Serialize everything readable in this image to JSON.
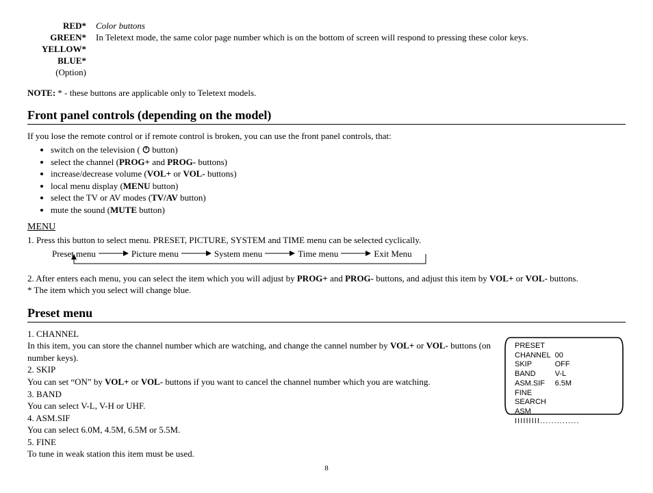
{
  "color_buttons": {
    "labels": [
      "RED*",
      "GREEN*",
      "YELLOW*",
      "BLUE*"
    ],
    "option": "(Option)",
    "title": "Color buttons",
    "desc": "In Teletext mode, the same color page number which is on the bottom of screen will respond to pressing these color keys."
  },
  "note": {
    "label": "NOTE:",
    "text": " * - these buttons are applicable only to Teletext models."
  },
  "section1": {
    "title": "Front panel controls (depending on the model)",
    "intro": "If you lose the remote control or if remote control is broken, you can use the front panel controls, that:",
    "bullets": {
      "b1a": "switch on the television ( ",
      "b1b": " button)",
      "b2a": "select the channel (",
      "b2s1": "PROG+",
      "b2m": " and ",
      "b2s2": "PROG-",
      "b2b": " buttons)",
      "b3a": "increase/decrease volume (",
      "b3s1": "VOL+",
      "b3m": " or ",
      "b3s2": "VOL-",
      "b3b": " buttons)",
      "b4a": "local menu display (",
      "b4s": "MENU",
      "b4b": " button)",
      "b5a": "select the TV or AV modes (",
      "b5s": "TV/AV",
      "b5b": " button)",
      "b6a": "mute the sound (",
      "b6s": "MUTE",
      "b6b": " button)"
    },
    "menu_label": "MENU",
    "menu_step1": "1. Press this button to select menu. PRESET, PICTURE, SYSTEM and TIME menu can be selected cyclically.",
    "flow": [
      "Preset menu",
      "Picture menu",
      "System menu",
      "Time menu",
      "Exit Menu"
    ],
    "menu_step2a": "2. After enters each menu, you can select the item which you will adjust by ",
    "menu_step2s1": "PROG+",
    "menu_step2m1": " and ",
    "menu_step2s2": "PROG-",
    "menu_step2m2": " buttons, and adjust this item by ",
    "menu_step2s3": "VOL+",
    "menu_step2m3": " or ",
    "menu_step2s4": "VOL-",
    "menu_step2b": " buttons.",
    "menu_star": "* The item which you select will change blue."
  },
  "section2": {
    "title": "Preset menu",
    "items": {
      "l1": "1. CHANNEL",
      "l1d_a": "In this item, you can store the channel number which are watching, and change the cannel number by ",
      "l1d_s1": "VOL+",
      "l1d_m": " or ",
      "l1d_s2": "VOL-",
      "l1d_b": " buttons (on number keys).",
      "l2": "2. SKIP",
      "l2d_a": "You can set “ON” by ",
      "l2d_s1": "VOL+",
      "l2d_m": " or ",
      "l2d_s2": "VOL-",
      "l2d_b": " buttons if you want to cancel the channel number which you are watching.",
      "l3": "3. BAND",
      "l3d": "You can select V-L, V-H or UHF.",
      "l4": "4. ASM.SIF",
      "l4d": "You can select 6.0M, 4.5M, 6.5M or 5.5M.",
      "l5": "5. FINE",
      "l5d": "To tune in weak station this item must be used."
    }
  },
  "tv": {
    "title": "PRESET",
    "rows": [
      [
        "CHANNEL",
        "00"
      ],
      [
        "SKIP",
        "OFF"
      ],
      [
        "BAND",
        "V-L"
      ],
      [
        "ASM.SIF",
        "6.5M"
      ],
      [
        "FINE",
        ""
      ],
      [
        "SEARCH",
        ""
      ],
      [
        "ASM",
        ""
      ]
    ],
    "bar": "I I I I I I I I I . . . . . . . . . . . . . ."
  },
  "page": "8"
}
